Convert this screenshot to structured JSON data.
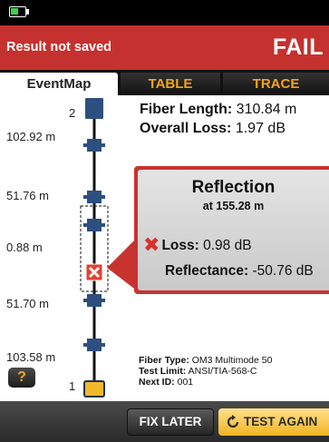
{
  "status_bar": {
    "battery_level": 0.55,
    "battery_color": "#3bd14a"
  },
  "result": {
    "left_text": "Result not saved",
    "right_text": "FAIL",
    "color": "#c5312f"
  },
  "tabs": [
    {
      "label": "EventMap",
      "active": true
    },
    {
      "label": "TABLE",
      "active": false
    },
    {
      "label": "TRACE",
      "active": false
    }
  ],
  "summary": {
    "fiber_length_label": "Fiber Length:",
    "fiber_length_value": "310.84 m",
    "overall_loss_label": "Overall Loss:",
    "overall_loss_value": "1.97 dB"
  },
  "map": {
    "end_port_number": "2",
    "start_port_number": "1",
    "distances": [
      "102.92 m",
      "51.76 m",
      "0.88 m",
      "51.70 m",
      "103.58 m"
    ]
  },
  "popup": {
    "title": "Reflection",
    "subtitle": "at 155.28 m",
    "loss_label": "Loss:",
    "loss_value": "0.98 dB",
    "reflectance_label": "Reflectance:",
    "reflectance_value": "-50.76 dB",
    "status_icon": "x-mark-icon"
  },
  "meta": {
    "fiber_type_label": "Fiber Type:",
    "fiber_type_value": "OM3 Multimode 50",
    "test_limit_label": "Test Limit:",
    "test_limit_value": "ANSI/TIA-568-C",
    "next_id_label": "Next ID:",
    "next_id_value": "001"
  },
  "help_label": "?",
  "buttons": {
    "fix_later": "FIX LATER",
    "test_again": "TEST AGAIN"
  }
}
